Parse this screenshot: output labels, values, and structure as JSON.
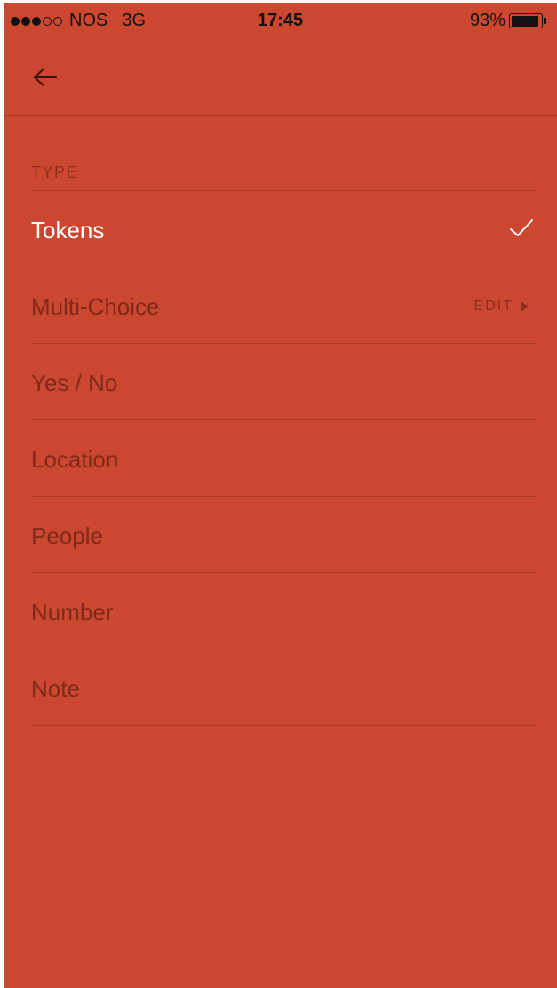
{
  "status_bar": {
    "carrier": "NOS",
    "network": "3G",
    "time": "17:45",
    "battery": "93%",
    "battery_level": 0.93,
    "signal_bars_filled": 3,
    "signal_bars_total": 5
  },
  "nav": {
    "back_icon": "arrow-left-icon"
  },
  "section": {
    "header": "TYPE"
  },
  "items": [
    {
      "label": "Tokens",
      "selected": true
    },
    {
      "label": "Multi-Choice",
      "selected": false,
      "action": "EDIT"
    },
    {
      "label": "Yes / No",
      "selected": false
    },
    {
      "label": "Location",
      "selected": false
    },
    {
      "label": "People",
      "selected": false
    },
    {
      "label": "Number",
      "selected": false
    },
    {
      "label": "Note",
      "selected": false
    }
  ],
  "icons": {
    "check": "checkmark-icon",
    "edit_arrow": "play-icon"
  },
  "colors": {
    "background": "#CC4730",
    "selected_text": "#FFFFFF",
    "muted_text": "#5F1E12"
  }
}
